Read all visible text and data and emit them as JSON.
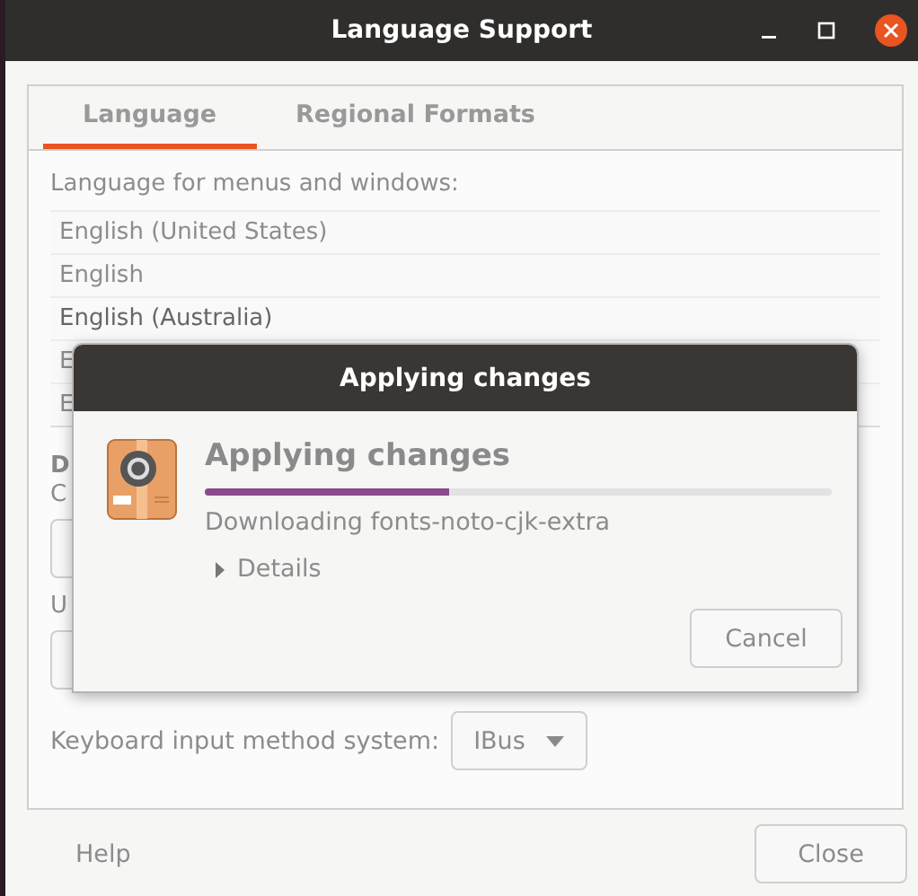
{
  "window": {
    "title": "Language Support"
  },
  "tabs": [
    {
      "label": "Language",
      "selected": true
    },
    {
      "label": "Regional Formats",
      "selected": false
    }
  ],
  "language_list": {
    "label": "Language for menus and windows:",
    "items": [
      "English (United States)",
      "English",
      "English (Australia)",
      "E",
      "E"
    ]
  },
  "install_section": {
    "heading": "D",
    "hint": "C"
  },
  "system_section": {
    "label": "U"
  },
  "input_method": {
    "label": "Keyboard input method system:",
    "value": "IBus"
  },
  "footer": {
    "help": "Help",
    "close": "Close"
  },
  "dialog": {
    "title": "Applying changes",
    "heading": "Applying changes",
    "level": 0.39,
    "status": "Downloading fonts-noto-cjk-extra",
    "details": {
      "label": "Details",
      "expanded": false
    },
    "cancel": "Cancel"
  }
}
